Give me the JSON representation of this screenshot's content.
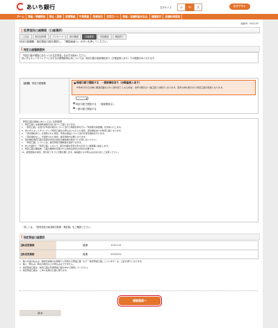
{
  "header": {
    "logo": "あいち銀行",
    "font_size_label": "文字サイズ",
    "font_sizes": [
      "小",
      "中",
      "大"
    ],
    "logout": "ログアウト"
  },
  "nav": [
    "ホーム",
    "預金・明細照会",
    "振込・振替",
    "定期預金",
    "外貨預金",
    "投資信託",
    "住宅ローン",
    "税金・各種料金の払込",
    "諸届受付",
    "各種利用設定"
  ],
  "page": {
    "screen_id": "画面ID：BAC105",
    "title": "投資信託口座開設（口座選択）",
    "steps": [
      "ご注意",
      "取引目的等",
      "アンケート",
      "取引確認",
      "口座選択",
      "内容確認",
      "開設完了"
    ],
    "active_step": 4,
    "intro": "特定口座種類・指定預金口座を選択し、「確認画面へ」ボタンを押してください。"
  },
  "section1": {
    "title": "特定口座種類選択",
    "note": [
      "「特定口座の開設にあたっての注意事項」を必ずお読みください。",
      "あいぎんネットダイレクトにおける口座開設申込みについては、特定口座の源泉徴収あり（分配金受入あり）での開設のみとなります。"
    ]
  },
  "form": {
    "required": "【必須】",
    "label": "特定口座種類",
    "option_main": "特定口座で開設する　－源泉徴収あり（分配金受入あり）",
    "option_desc": "※年末1月1日以降に郵送回答をされて受付完了となる場合、当年の取引は一般口座での取引となります。翌年以降の取引から特定口座の取扱となります。",
    "select_value": "－－－－",
    "option_b": "特定口座で開設する　－源泉徴収なし",
    "option_c": "一般口座で開設する"
  },
  "section2_notes": [
    "【特定口座の開設にあたってのご注意事項】",
    "1．特定口座とは金融商品取引法に基づく口座となります。",
    "2．「特定口座」は当行が年間の取引について当行で税務計算を行い「年間取引報告書」を作成いたします。",
    "3．あいぎんネットダイレクトで特定口座をお申込みいただいた場合、源泉徴収ありの特定口座となります。",
    "4．「源泉徴収あり」を選択された場合、年間の損益について当行が源泉徴収を行います。",
    "5．「源泉徴収なし」を選択された場合、確定申告が必要となります。",
    "6．源泉徴収選択口座の変更は年初の最初の譲渡等の前までにお申し出ください。",
    "7．「特定口座」については、確定申告不要制度を選択できます。",
    "8．あいち銀行と「特定口座」において、取引内容を翌年1月31日までに税務署に提出します。",
    "9．特定口座の開設後、口座の種類を変更される場合は所定の手続が必要です。",
    "10．郵送回答の場合、受付完了までに日数を要します。本画面からの申込みは次の点にご注意ください。"
  ],
  "notice_links": "詳しくは、「投資信託の総合取引約款・規定集」をご確認ください。",
  "section3": {
    "title": "指定預金口座選択",
    "accounts": [
      {
        "branch": "本店営業部",
        "type": "普通",
        "number": "1111111"
      },
      {
        "branch": "本店営業部",
        "type": "普通",
        "number": "2222222"
      }
    ]
  },
  "bottom_notes": [
    "1．購入代金の払込み、解約代金等のお受取りに利用する預金口座（以下「指定預金口座」といいます）は、上記の通りとなります。",
    "2．購入（申込み）時点の残高以上の申込みはできません。",
    "3．指定預金口座は、総合口座の普通預金口座の中から選択してください。",
    "4．指定預金口座は、ご本人名義の口座に限ります。"
  ],
  "buttons": {
    "confirm": "確認画面へ",
    "back": "戻る"
  }
}
